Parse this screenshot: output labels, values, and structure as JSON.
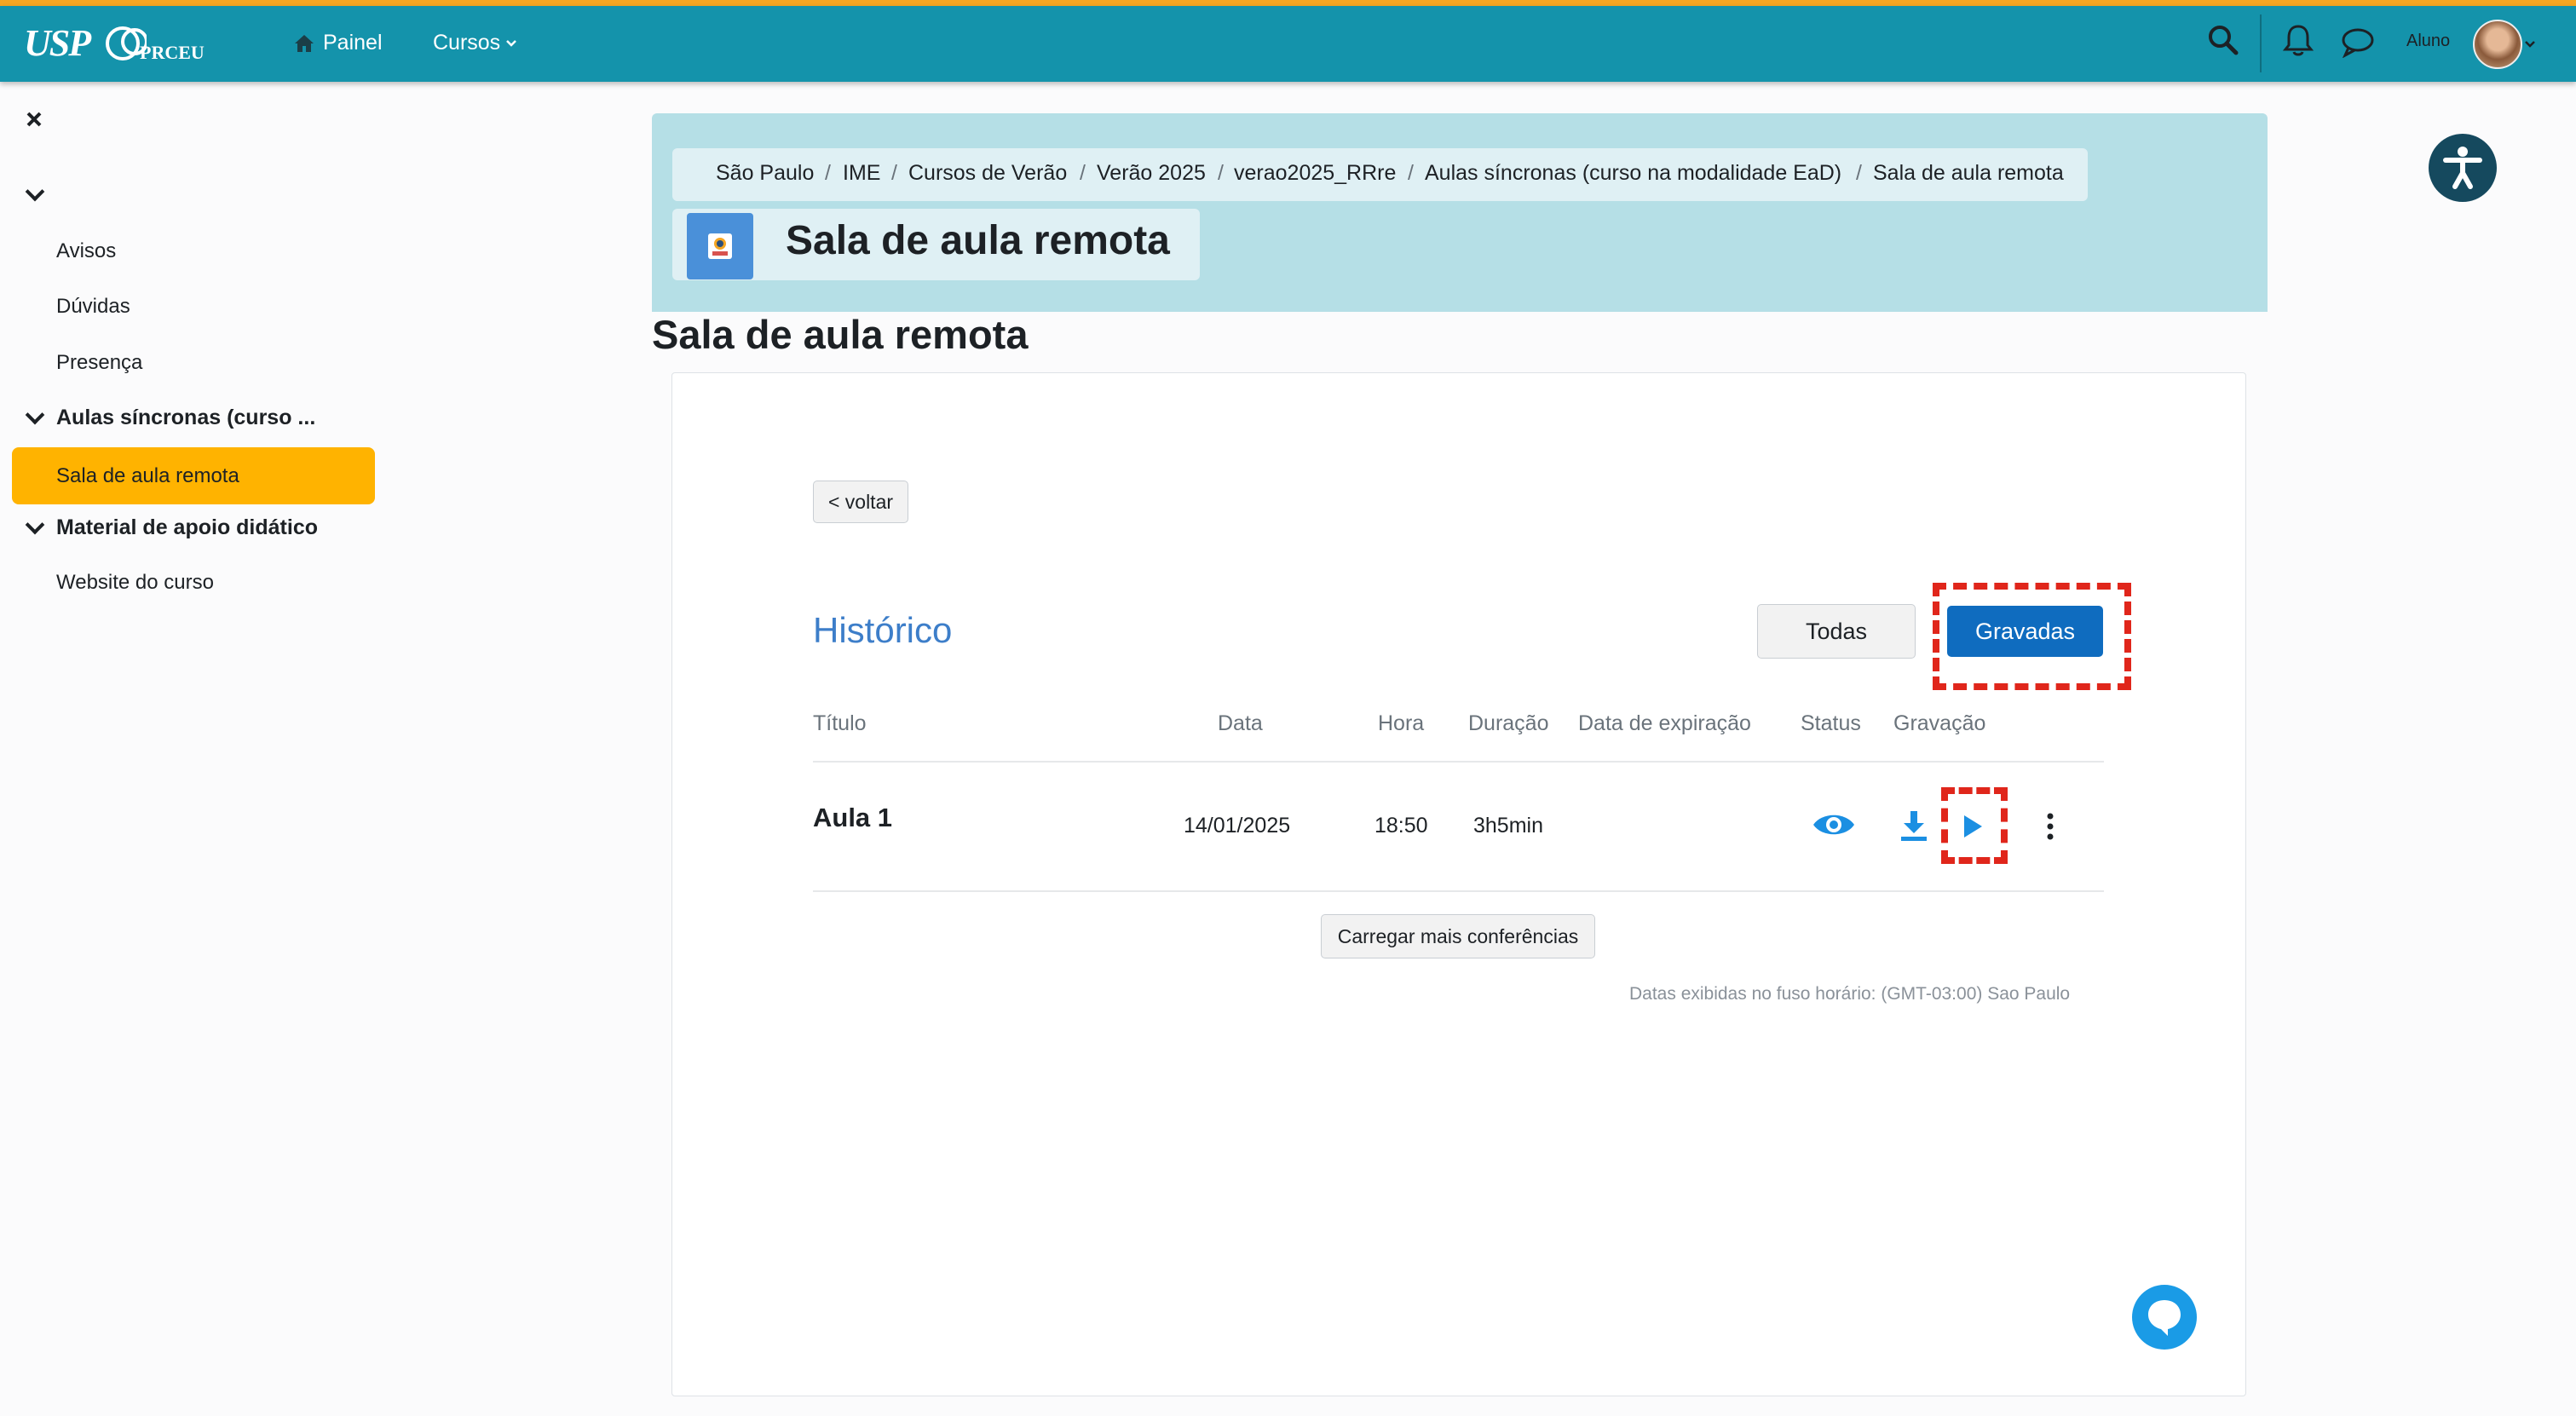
{
  "navbar": {
    "logo_usp": "USP",
    "logo_prceu": "PRCEU",
    "painel": "Painel",
    "cursos": "Cursos",
    "user_label": "Aluno"
  },
  "sidebar": {
    "items": [
      {
        "label": "Avisos"
      },
      {
        "label": "Dúvidas"
      },
      {
        "label": "Presença"
      }
    ],
    "section_sync": "Aulas síncronas (curso ...",
    "active_item": "Sala de aula remota",
    "section_material": "Material de apoio didático",
    "website": "Website do curso"
  },
  "breadcrumb": [
    "São Paulo",
    "IME",
    "Cursos de Verão",
    "Verão 2025",
    "verao2025_RRre",
    "Aulas síncronas (curso na modalidade EaD)",
    "Sala de aula remota"
  ],
  "page": {
    "header_title": "Sala de aula remota",
    "title": "Sala de aula remota"
  },
  "content": {
    "back_button": "< voltar",
    "history_title": "Histórico",
    "filter_all": "Todas",
    "filter_recorded": "Gravadas",
    "columns": [
      "Título",
      "Data",
      "Hora",
      "Duração",
      "Data de expiração",
      "Status",
      "Gravação"
    ],
    "rows": [
      {
        "title": "Aula 1",
        "date": "14/01/2025",
        "time": "18:50",
        "duration": "3h5min",
        "expiration": ""
      }
    ],
    "load_more": "Carregar mais conferências",
    "timezone_note": "Datas exibidas no fuso horário: (GMT-03:00) Sao Paulo"
  },
  "colors": {
    "navbar": "#1493ab",
    "accent_stripe": "#f5a623",
    "active_sidebar": "#ffb300",
    "primary_button": "#0f6cbf",
    "highlight": "#e0261b"
  }
}
